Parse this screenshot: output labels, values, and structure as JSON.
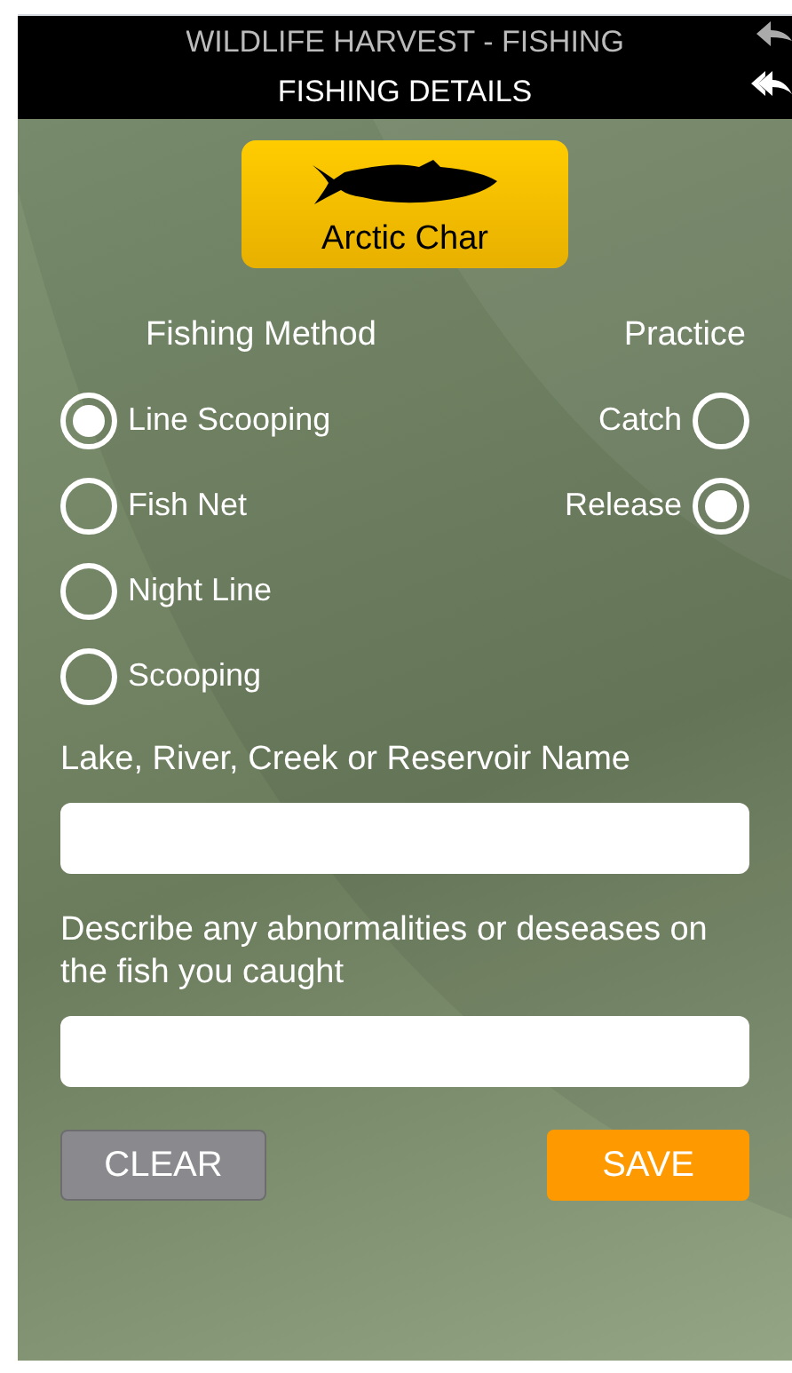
{
  "header": {
    "app_title": "WILDLIFE HARVEST - FISHING",
    "screen_title": "FISHING DETAILS"
  },
  "species": {
    "label": "Arctic Char"
  },
  "fishing_method": {
    "title": "Fishing Method",
    "options": [
      {
        "label": "Line Scooping",
        "selected": true
      },
      {
        "label": "Fish Net",
        "selected": false
      },
      {
        "label": "Night Line",
        "selected": false
      },
      {
        "label": "Scooping",
        "selected": false
      }
    ]
  },
  "practice": {
    "title": "Practice",
    "options": [
      {
        "label": "Catch",
        "selected": false
      },
      {
        "label": "Release",
        "selected": true
      }
    ]
  },
  "fields": [
    {
      "label": "Lake, River, Creek or Reservoir Name"
    },
    {
      "label": "Describe any abnormalities or deseases on the fish you caught"
    }
  ],
  "buttons": [
    {
      "label": "CLEAR",
      "kind": "secondary"
    },
    {
      "label": "SAVE",
      "kind": "primary"
    }
  ]
}
